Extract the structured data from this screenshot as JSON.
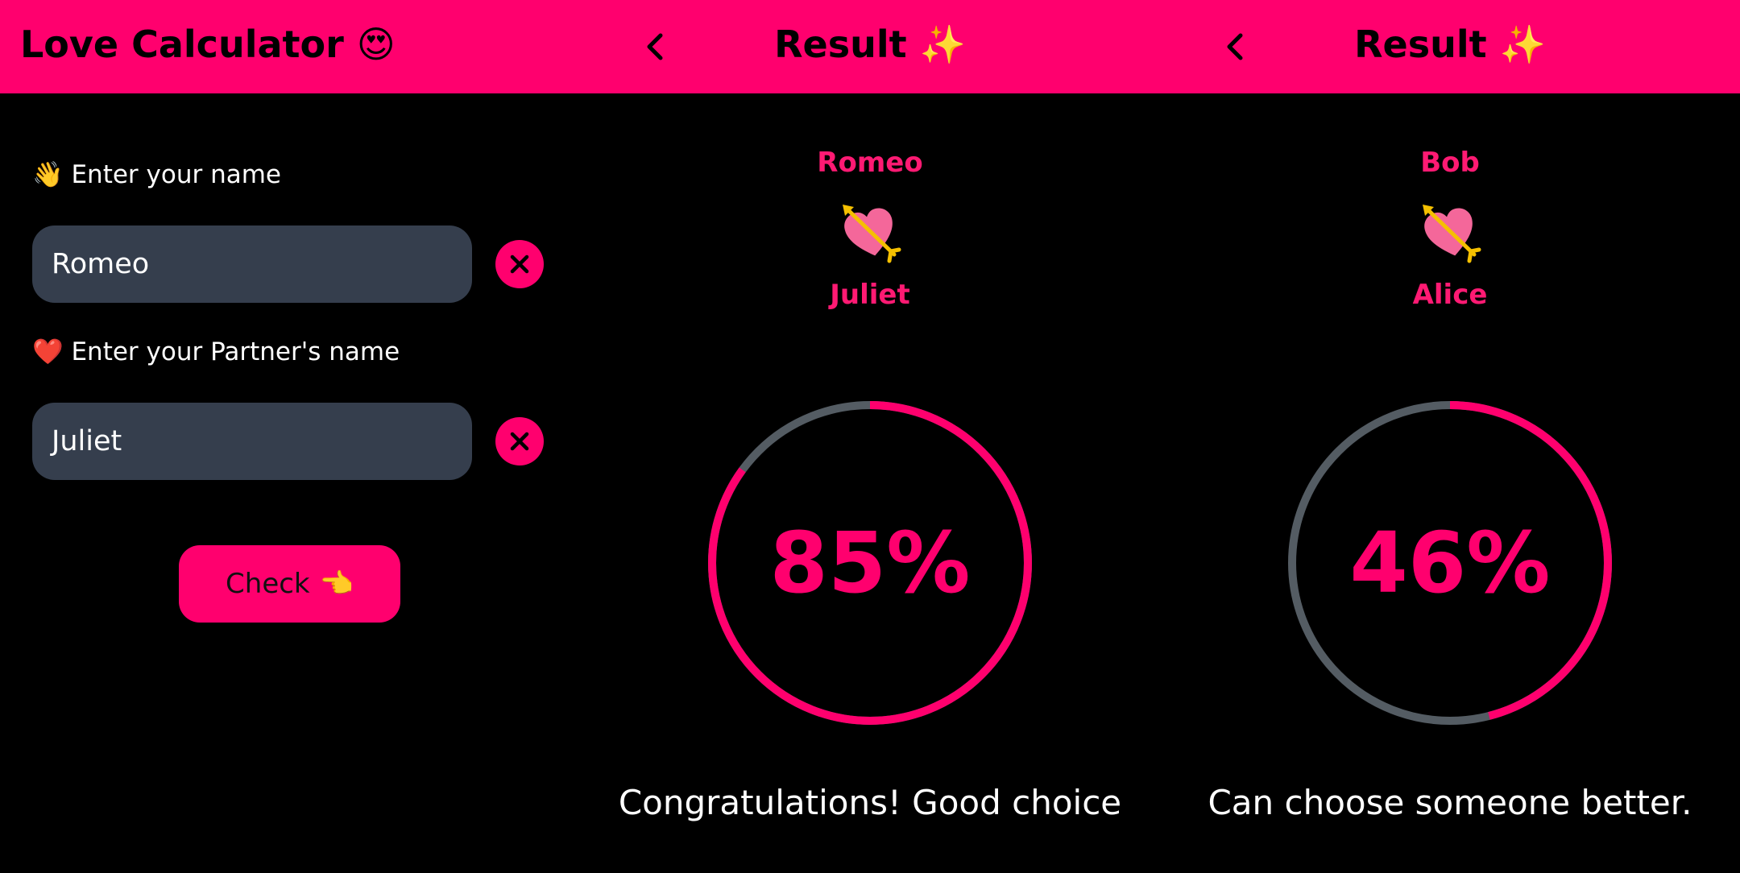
{
  "colors": {
    "accent": "#ff006e",
    "track": "#545c63",
    "input_bg": "#353e4d",
    "background": "#000000"
  },
  "calculator": {
    "title": "Love Calculator",
    "title_emoji": "😍",
    "name_label_emoji": "👋",
    "name_label": "Enter your name",
    "name_value": "Romeo",
    "partner_label_emoji": "❤️",
    "partner_label": "Enter your Partner's name",
    "partner_value": "Juliet",
    "check_label": "Check",
    "check_emoji": "👈",
    "icons": {
      "clear": "close-icon"
    }
  },
  "results": [
    {
      "title": "Result",
      "title_emoji": "✨",
      "name_one": "Romeo",
      "cupid_icon": "heart-with-arrow-icon",
      "name_two": "Juliet",
      "percent_text": "85%",
      "percent": 85,
      "message": "Congratulations! Good choice"
    },
    {
      "title": "Result",
      "title_emoji": "✨",
      "name_one": "Bob",
      "cupid_icon": "heart-with-arrow-icon",
      "name_two": "Alice",
      "percent_text": "46%",
      "percent": 46,
      "message": "Can choose someone better."
    }
  ]
}
